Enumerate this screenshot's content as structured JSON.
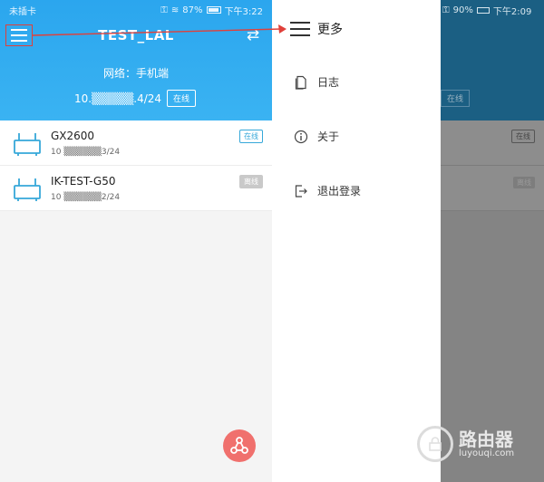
{
  "left": {
    "status": {
      "carrier": "未插卡",
      "battery_text": "87%",
      "time": "下午3:22"
    },
    "header": {
      "title": "TEST_LAL",
      "network_label": "网络：手机端",
      "ip_prefix": "10.",
      "ip_suffix": ".4/24",
      "online_badge": "在线"
    },
    "devices": [
      {
        "name": "GX2600",
        "ip_prefix": "10",
        "ip_suffix": "3/24",
        "status": "在线"
      },
      {
        "name": "IK-TEST-G50",
        "ip_prefix": "10",
        "ip_suffix": "2/24",
        "status": "离线"
      }
    ],
    "colors": {
      "header": "#2ba6ee",
      "fab": "#f0706d",
      "online": "#36a8d9"
    }
  },
  "right": {
    "status": {
      "battery_text": "90%",
      "time": "下午2:09"
    },
    "drawer": {
      "title": "更多",
      "items": [
        {
          "label": "日志",
          "icon": "document-icon"
        },
        {
          "label": "关于",
          "icon": "info-icon"
        },
        {
          "label": "退出登录",
          "icon": "logout-icon"
        }
      ]
    },
    "background": {
      "online_badge": "在线",
      "row_badges": [
        "在线",
        "离线"
      ]
    }
  },
  "watermark": {
    "big": "路由器",
    "small": "luyouqi.com"
  }
}
